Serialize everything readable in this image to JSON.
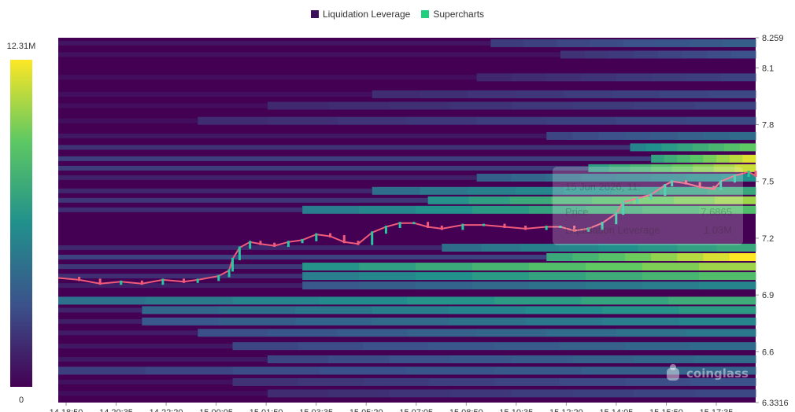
{
  "legend": [
    {
      "label": "Liquidation Leverage",
      "color": "#3b0f5a"
    },
    {
      "label": "Supercharts",
      "color": "#1fcf7e"
    }
  ],
  "colorbar": {
    "max_label": "12.31M",
    "min_label": "0"
  },
  "tooltip": {
    "date": "15 Jun 2026, 11:",
    "price_label": "Price",
    "price_value": "7.6865",
    "leverage_label": "Liquidation Leverage",
    "leverage_value": "1.03M"
  },
  "watermark": "coinglass",
  "chart_data": {
    "type": "heatmap",
    "y_axis": {
      "range": [
        6.3316,
        8.259
      ],
      "tick_labels": [
        "8.259",
        "8.1",
        "7.8",
        "7.5",
        "7.2",
        "6.9",
        "6.6",
        "6.3316"
      ]
    },
    "x_axis": {
      "tick_labels": [
        "14 18:50",
        "14 20:35",
        "14 22:20",
        "15 00:05",
        "15 01:50",
        "15 03:35",
        "15 05:20",
        "15 07:05",
        "15 08:50",
        "15 10:35",
        "15 12:20",
        "15 14:05",
        "15 15:50",
        "15 17:35"
      ]
    },
    "colorscale": [
      "#440154",
      "#3b528b",
      "#21908c",
      "#5dc863",
      "#fde725"
    ],
    "value_range": [
      0,
      12.31
    ],
    "value_unit": "M",
    "bands": [
      {
        "price": 8.23,
        "start": 0.62,
        "intensity": 0.3
      },
      {
        "price": 8.17,
        "start": 0.72,
        "intensity": 0.25
      },
      {
        "price": 8.05,
        "start": 0.6,
        "intensity": 0.2
      },
      {
        "price": 7.96,
        "start": 0.45,
        "intensity": 0.22
      },
      {
        "price": 7.9,
        "start": 0.3,
        "intensity": 0.2
      },
      {
        "price": 7.82,
        "start": 0.2,
        "intensity": 0.22
      },
      {
        "price": 7.74,
        "start": 0.7,
        "intensity": 0.35
      },
      {
        "price": 7.68,
        "start": 0.82,
        "intensity": 0.75
      },
      {
        "price": 7.62,
        "start": 0.85,
        "intensity": 0.95
      },
      {
        "price": 7.57,
        "start": 0.76,
        "intensity": 0.92
      },
      {
        "price": 7.52,
        "start": 0.6,
        "intensity": 0.5
      },
      {
        "price": 7.45,
        "start": 0.45,
        "intensity": 0.6
      },
      {
        "price": 7.4,
        "start": 0.53,
        "intensity": 0.85
      },
      {
        "price": 7.35,
        "start": 0.35,
        "intensity": 0.7
      },
      {
        "price": 7.15,
        "start": 0.55,
        "intensity": 0.6
      },
      {
        "price": 7.1,
        "start": 0.7,
        "intensity": 1.0
      },
      {
        "price": 7.05,
        "start": 0.35,
        "intensity": 0.85
      },
      {
        "price": 7.0,
        "start": 0.35,
        "intensity": 0.7
      },
      {
        "price": 6.95,
        "start": 0.35,
        "intensity": 0.45
      },
      {
        "price": 6.87,
        "start": 0.0,
        "intensity": 0.62
      },
      {
        "price": 6.82,
        "start": 0.12,
        "intensity": 0.55
      },
      {
        "price": 6.76,
        "start": 0.12,
        "intensity": 0.45
      },
      {
        "price": 6.7,
        "start": 0.2,
        "intensity": 0.4
      },
      {
        "price": 6.63,
        "start": 0.25,
        "intensity": 0.35
      },
      {
        "price": 6.56,
        "start": 0.3,
        "intensity": 0.35
      },
      {
        "price": 6.5,
        "start": 0.0,
        "intensity": 0.32
      },
      {
        "price": 6.44,
        "start": 0.25,
        "intensity": 0.25
      },
      {
        "price": 6.38,
        "start": 0.3,
        "intensity": 0.22
      }
    ],
    "price_series": [
      {
        "t": 0.0,
        "price": 6.99
      },
      {
        "t": 0.03,
        "price": 6.98
      },
      {
        "t": 0.06,
        "price": 6.96
      },
      {
        "t": 0.09,
        "price": 6.97
      },
      {
        "t": 0.12,
        "price": 6.96
      },
      {
        "t": 0.15,
        "price": 6.98
      },
      {
        "t": 0.18,
        "price": 6.97
      },
      {
        "t": 0.2,
        "price": 6.98
      },
      {
        "t": 0.23,
        "price": 7.0
      },
      {
        "t": 0.245,
        "price": 7.03
      },
      {
        "t": 0.25,
        "price": 7.09
      },
      {
        "t": 0.26,
        "price": 7.15
      },
      {
        "t": 0.275,
        "price": 7.18
      },
      {
        "t": 0.29,
        "price": 7.17
      },
      {
        "t": 0.31,
        "price": 7.16
      },
      {
        "t": 0.33,
        "price": 7.18
      },
      {
        "t": 0.35,
        "price": 7.19
      },
      {
        "t": 0.37,
        "price": 7.22
      },
      {
        "t": 0.39,
        "price": 7.21
      },
      {
        "t": 0.41,
        "price": 7.18
      },
      {
        "t": 0.43,
        "price": 7.17
      },
      {
        "t": 0.45,
        "price": 7.23
      },
      {
        "t": 0.47,
        "price": 7.26
      },
      {
        "t": 0.49,
        "price": 7.28
      },
      {
        "t": 0.51,
        "price": 7.28
      },
      {
        "t": 0.53,
        "price": 7.26
      },
      {
        "t": 0.55,
        "price": 7.25
      },
      {
        "t": 0.58,
        "price": 7.27
      },
      {
        "t": 0.61,
        "price": 7.27
      },
      {
        "t": 0.64,
        "price": 7.26
      },
      {
        "t": 0.67,
        "price": 7.25
      },
      {
        "t": 0.7,
        "price": 7.26
      },
      {
        "t": 0.72,
        "price": 7.26
      },
      {
        "t": 0.74,
        "price": 7.24
      },
      {
        "t": 0.76,
        "price": 7.25
      },
      {
        "t": 0.78,
        "price": 7.28
      },
      {
        "t": 0.8,
        "price": 7.33
      },
      {
        "t": 0.81,
        "price": 7.39
      },
      {
        "t": 0.83,
        "price": 7.41
      },
      {
        "t": 0.85,
        "price": 7.43
      },
      {
        "t": 0.87,
        "price": 7.48
      },
      {
        "t": 0.88,
        "price": 7.5
      },
      {
        "t": 0.9,
        "price": 7.49
      },
      {
        "t": 0.92,
        "price": 7.47
      },
      {
        "t": 0.94,
        "price": 7.46
      },
      {
        "t": 0.95,
        "price": 7.5
      },
      {
        "t": 0.97,
        "price": 7.53
      },
      {
        "t": 0.99,
        "price": 7.55
      },
      {
        "t": 1.0,
        "price": 7.53
      }
    ]
  }
}
